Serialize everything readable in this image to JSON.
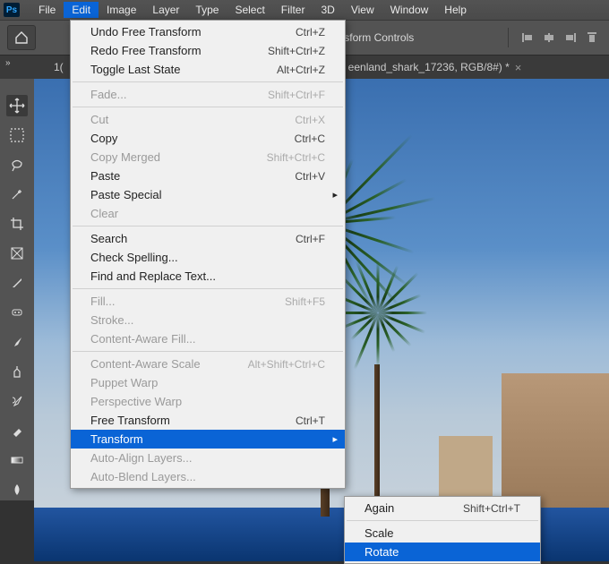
{
  "app": {
    "logo": "Ps"
  },
  "menubar": {
    "items": [
      "File",
      "Edit",
      "Image",
      "Layer",
      "Type",
      "Select",
      "Filter",
      "3D",
      "View",
      "Window",
      "Help"
    ],
    "active_index": 1
  },
  "optionsbar": {
    "transform_label": "Transform Controls"
  },
  "tabstrip": {
    "prefix": "1(",
    "tab_label": "eenland_shark_17236, RGB/8#) *"
  },
  "tools": [
    "move",
    "marquee",
    "lasso",
    "wand",
    "crop",
    "frame",
    "eyedropper",
    "spot-heal",
    "brush",
    "clone",
    "history-brush",
    "eraser",
    "gradient",
    "blur"
  ],
  "edit_menu": {
    "groups": [
      [
        {
          "label": "Undo Free Transform",
          "shortcut": "Ctrl+Z",
          "enabled": true
        },
        {
          "label": "Redo Free Transform",
          "shortcut": "Shift+Ctrl+Z",
          "enabled": true
        },
        {
          "label": "Toggle Last State",
          "shortcut": "Alt+Ctrl+Z",
          "enabled": true
        }
      ],
      [
        {
          "label": "Fade...",
          "shortcut": "Shift+Ctrl+F",
          "enabled": false
        }
      ],
      [
        {
          "label": "Cut",
          "shortcut": "Ctrl+X",
          "enabled": false
        },
        {
          "label": "Copy",
          "shortcut": "Ctrl+C",
          "enabled": true
        },
        {
          "label": "Copy Merged",
          "shortcut": "Shift+Ctrl+C",
          "enabled": false
        },
        {
          "label": "Paste",
          "shortcut": "Ctrl+V",
          "enabled": true
        },
        {
          "label": "Paste Special",
          "shortcut": "",
          "enabled": true,
          "submenu": true
        },
        {
          "label": "Clear",
          "shortcut": "",
          "enabled": false
        }
      ],
      [
        {
          "label": "Search",
          "shortcut": "Ctrl+F",
          "enabled": true
        },
        {
          "label": "Check Spelling...",
          "shortcut": "",
          "enabled": true
        },
        {
          "label": "Find and Replace Text...",
          "shortcut": "",
          "enabled": true
        }
      ],
      [
        {
          "label": "Fill...",
          "shortcut": "Shift+F5",
          "enabled": false
        },
        {
          "label": "Stroke...",
          "shortcut": "",
          "enabled": false
        },
        {
          "label": "Content-Aware Fill...",
          "shortcut": "",
          "enabled": false
        }
      ],
      [
        {
          "label": "Content-Aware Scale",
          "shortcut": "Alt+Shift+Ctrl+C",
          "enabled": false
        },
        {
          "label": "Puppet Warp",
          "shortcut": "",
          "enabled": false
        },
        {
          "label": "Perspective Warp",
          "shortcut": "",
          "enabled": false
        },
        {
          "label": "Free Transform",
          "shortcut": "Ctrl+T",
          "enabled": true
        },
        {
          "label": "Transform",
          "shortcut": "",
          "enabled": true,
          "submenu": true,
          "highlight": true
        },
        {
          "label": "Auto-Align Layers...",
          "shortcut": "",
          "enabled": false
        },
        {
          "label": "Auto-Blend Layers...",
          "shortcut": "",
          "enabled": false
        }
      ]
    ]
  },
  "transform_submenu": {
    "items": [
      {
        "label": "Again",
        "shortcut": "Shift+Ctrl+T",
        "enabled": true,
        "sep_after": true
      },
      {
        "label": "Scale",
        "shortcut": "",
        "enabled": true
      },
      {
        "label": "Rotate",
        "shortcut": "",
        "enabled": true,
        "highlight": true
      }
    ]
  }
}
